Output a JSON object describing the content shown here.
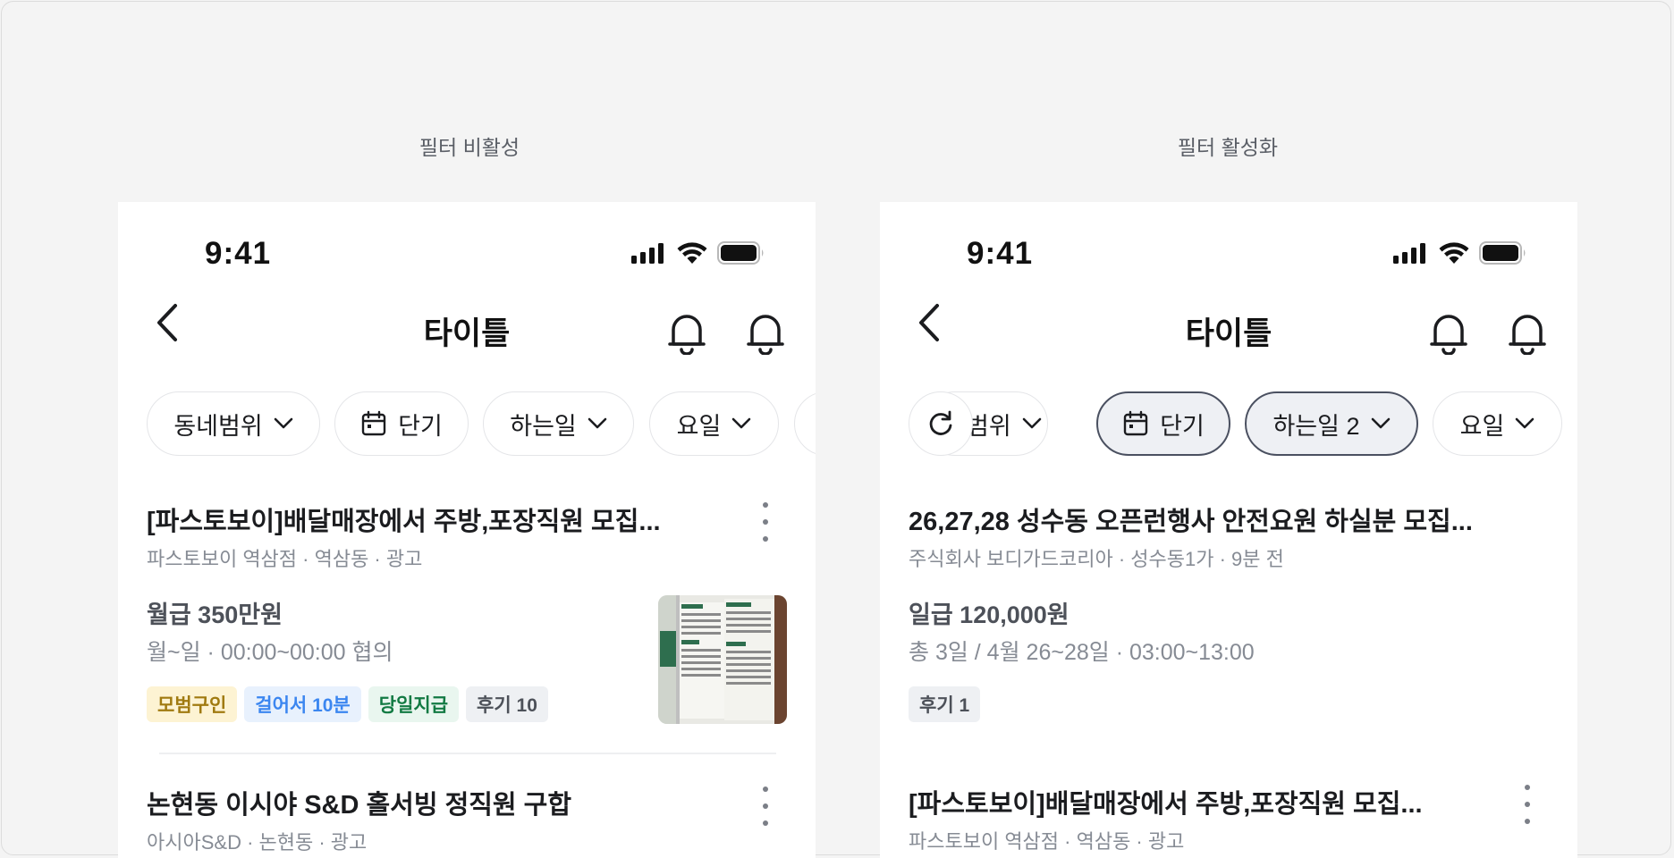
{
  "labels": {
    "left": "필터 비활성",
    "right": "필터 활성화"
  },
  "colors": {
    "tag_yellow_bg": "#fdf3d3",
    "tag_yellow_fg": "#a07a10",
    "tag_blue_bg": "#e8f1fd",
    "tag_blue_fg": "#3b86f0",
    "tag_green_bg": "#e9f6ef",
    "tag_green_fg": "#127a43",
    "tag_gray_bg": "#eef0f3",
    "tag_gray_fg": "#4d5159"
  },
  "left": {
    "status": {
      "time": "9:41"
    },
    "nav": {
      "title": "타이틀"
    },
    "chips": [
      "동네범위",
      "단기",
      "하는일",
      "요일"
    ],
    "cards": [
      {
        "title": "[파스토보이]배달매장에서 주방,포장직원 모집...",
        "sub": "파스토보이 역삼점 · 역삼동 · 광고",
        "pay": "월급 350만원",
        "schedule": "월~일 · 00:00~00:00 협의",
        "tags": [
          "모범구인",
          "걸어서 10분",
          "당일지급",
          "후기 10"
        ]
      },
      {
        "title": "논현동 이시야 S&D 홀서빙 정직원 구합",
        "sub": "아시아S&D · 논현동 · 광고"
      }
    ]
  },
  "right": {
    "status": {
      "time": "9:41"
    },
    "nav": {
      "title": "타이틀"
    },
    "chips": [
      "범위",
      "단기",
      "하는일 2",
      "요일"
    ],
    "cards": [
      {
        "title": "26,27,28 성수동 오픈런행사 안전요원 하실분 모집...",
        "sub": "주식회사 보디가드코리아 · 성수동1가 · 9분 전",
        "pay": "일급 120,000원",
        "schedule": "총 3일 / 4월 26~28일 · 03:00~13:00",
        "tags": [
          "후기 1"
        ]
      },
      {
        "title": "[파스토보이]배달매장에서 주방,포장직원 모집...",
        "sub": "파스토보이 역삼점 · 역삼동 · 광고"
      }
    ]
  }
}
